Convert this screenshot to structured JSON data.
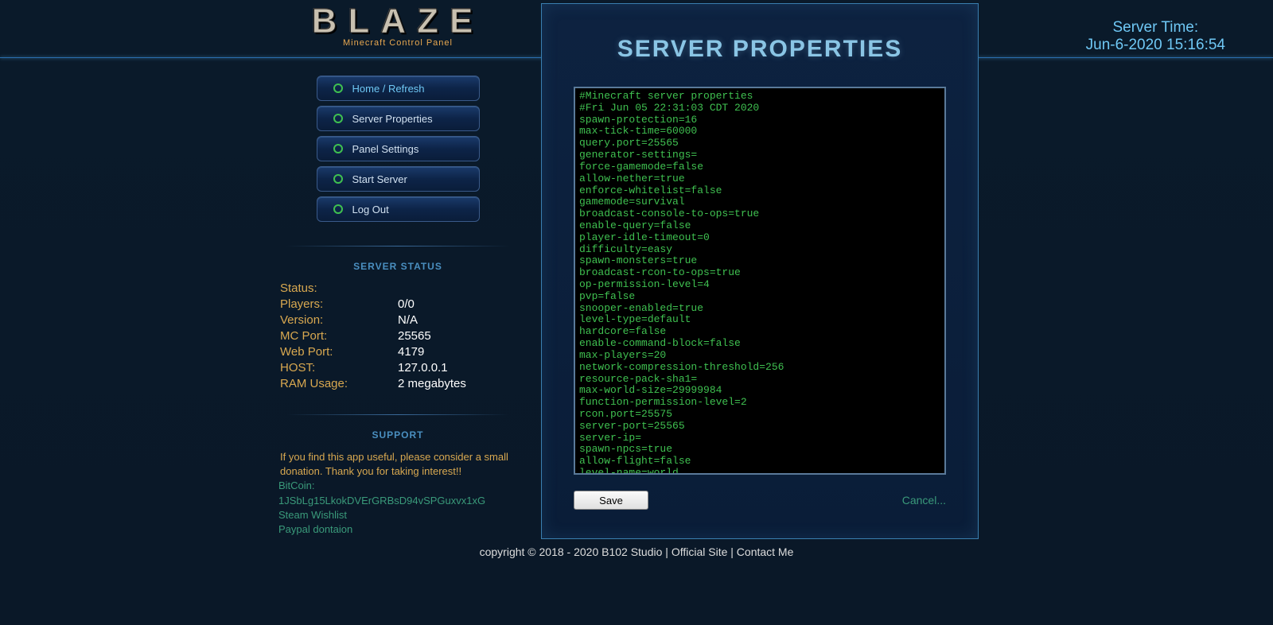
{
  "logo": {
    "title": "BLAZE",
    "subtitle": "Minecraft Control Panel"
  },
  "server_time": {
    "label": "Server Time:",
    "value": "Jun-6-2020 15:16:54"
  },
  "nav": {
    "items": [
      {
        "label": "Home / Refresh",
        "active": true
      },
      {
        "label": "Server Properties",
        "active": false
      },
      {
        "label": "Panel Settings",
        "active": false
      },
      {
        "label": "Start Server",
        "active": false
      },
      {
        "label": "Log Out",
        "active": false
      }
    ]
  },
  "status": {
    "header": "SERVER STATUS",
    "rows": [
      {
        "label": "Status:",
        "value": ""
      },
      {
        "label": "Players:",
        "value": "0/0"
      },
      {
        "label": "Version:",
        "value": "N/A"
      },
      {
        "label": "MC Port:",
        "value": "25565"
      },
      {
        "label": "Web Port:",
        "value": "4179"
      },
      {
        "label": "HOST:",
        "value": "127.0.0.1"
      },
      {
        "label": "RAM Usage:",
        "value": "2 megabytes"
      }
    ]
  },
  "support": {
    "header": "SUPPORT",
    "text": "If you find this app useful, please consider a small donation. Thank you for taking interest!!",
    "links": [
      "BitCoin: 1JSbLg15LkokDVErGRBsD94vSPGuxvx1xG",
      "Steam Wishlist",
      "Paypal dontaion"
    ]
  },
  "panel": {
    "title": "SERVER PROPERTIES",
    "properties_text": "#Minecraft server properties\n#Fri Jun 05 22:31:03 CDT 2020\nspawn-protection=16\nmax-tick-time=60000\nquery.port=25565\ngenerator-settings=\nforce-gamemode=false\nallow-nether=true\nenforce-whitelist=false\ngamemode=survival\nbroadcast-console-to-ops=true\nenable-query=false\nplayer-idle-timeout=0\ndifficulty=easy\nspawn-monsters=true\nbroadcast-rcon-to-ops=true\nop-permission-level=4\npvp=false\nsnooper-enabled=true\nlevel-type=default\nhardcore=false\nenable-command-block=false\nmax-players=20\nnetwork-compression-threshold=256\nresource-pack-sha1=\nmax-world-size=29999984\nfunction-permission-level=2\nrcon.port=25575\nserver-port=25565\nserver-ip=\nspawn-npcs=true\nallow-flight=false\nlevel-name=world",
    "save_label": "Save",
    "cancel_label": "Cancel..."
  },
  "footer": {
    "copyright": "copyright © 2018 - 2020 B102 Studio",
    "official_site": "Official Site",
    "contact": "Contact Me",
    "sep": " | "
  }
}
